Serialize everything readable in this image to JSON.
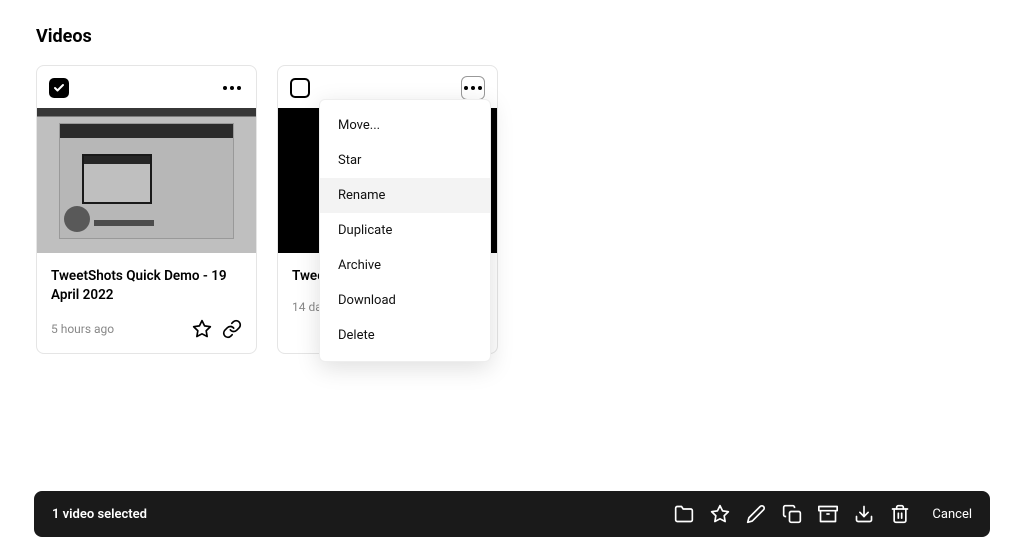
{
  "page": {
    "title": "Videos"
  },
  "cards": [
    {
      "title": "TweetShots Quick Demo - 19 April 2022",
      "timestamp": "5 hours ago",
      "checked": true
    },
    {
      "title": "Twee",
      "timestamp": "14 day",
      "checked": false
    }
  ],
  "contextMenu": {
    "items": [
      {
        "label": "Move..."
      },
      {
        "label": "Star"
      },
      {
        "label": "Rename",
        "hover": true
      },
      {
        "label": "Duplicate"
      },
      {
        "label": "Archive"
      },
      {
        "label": "Download"
      },
      {
        "label": "Delete"
      }
    ]
  },
  "selectionBar": {
    "text": "1 video selected",
    "cancel": "Cancel"
  }
}
